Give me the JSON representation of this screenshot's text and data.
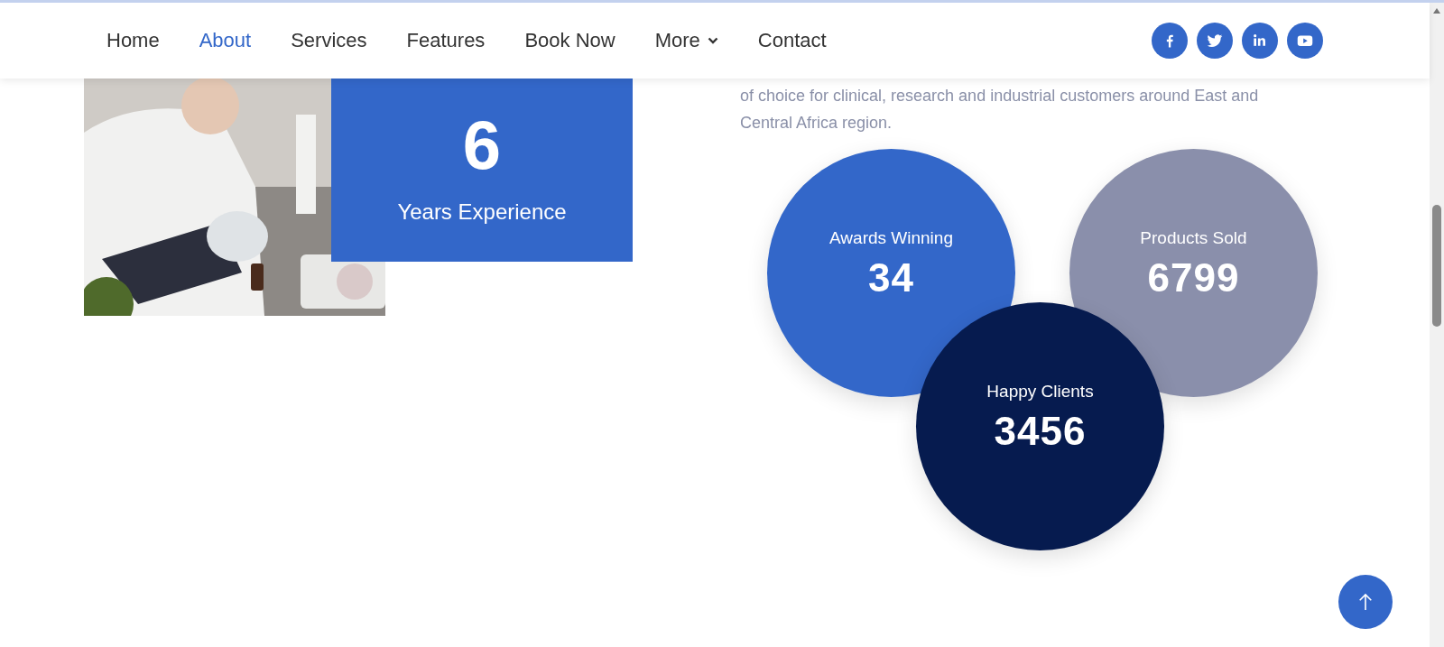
{
  "nav": {
    "items": [
      {
        "label": "Home",
        "selected": false,
        "dropdown": false
      },
      {
        "label": "About",
        "selected": true,
        "dropdown": false
      },
      {
        "label": "Services",
        "selected": false,
        "dropdown": false
      },
      {
        "label": "Features",
        "selected": false,
        "dropdown": false
      },
      {
        "label": "Book Now",
        "selected": false,
        "dropdown": false
      },
      {
        "label": "More",
        "selected": false,
        "dropdown": true
      },
      {
        "label": "Contact",
        "selected": false,
        "dropdown": false
      }
    ],
    "social": [
      {
        "kind": "facebook"
      },
      {
        "kind": "twitter"
      },
      {
        "kind": "linkedin"
      },
      {
        "kind": "youtube"
      }
    ]
  },
  "experience": {
    "number": "6",
    "label": "Years Experience"
  },
  "intro": {
    "lines": [
      "of choice for clinical, research and industrial customers around East and",
      "Central Africa region."
    ]
  },
  "stats": [
    {
      "label": "Awards Winning",
      "value": "34",
      "color": "#3367c9"
    },
    {
      "label": "Products Sold",
      "value": "6799",
      "color": "#8a8fab"
    },
    {
      "label": "Happy Clients",
      "value": "3456",
      "color": "#061b4f"
    }
  ]
}
